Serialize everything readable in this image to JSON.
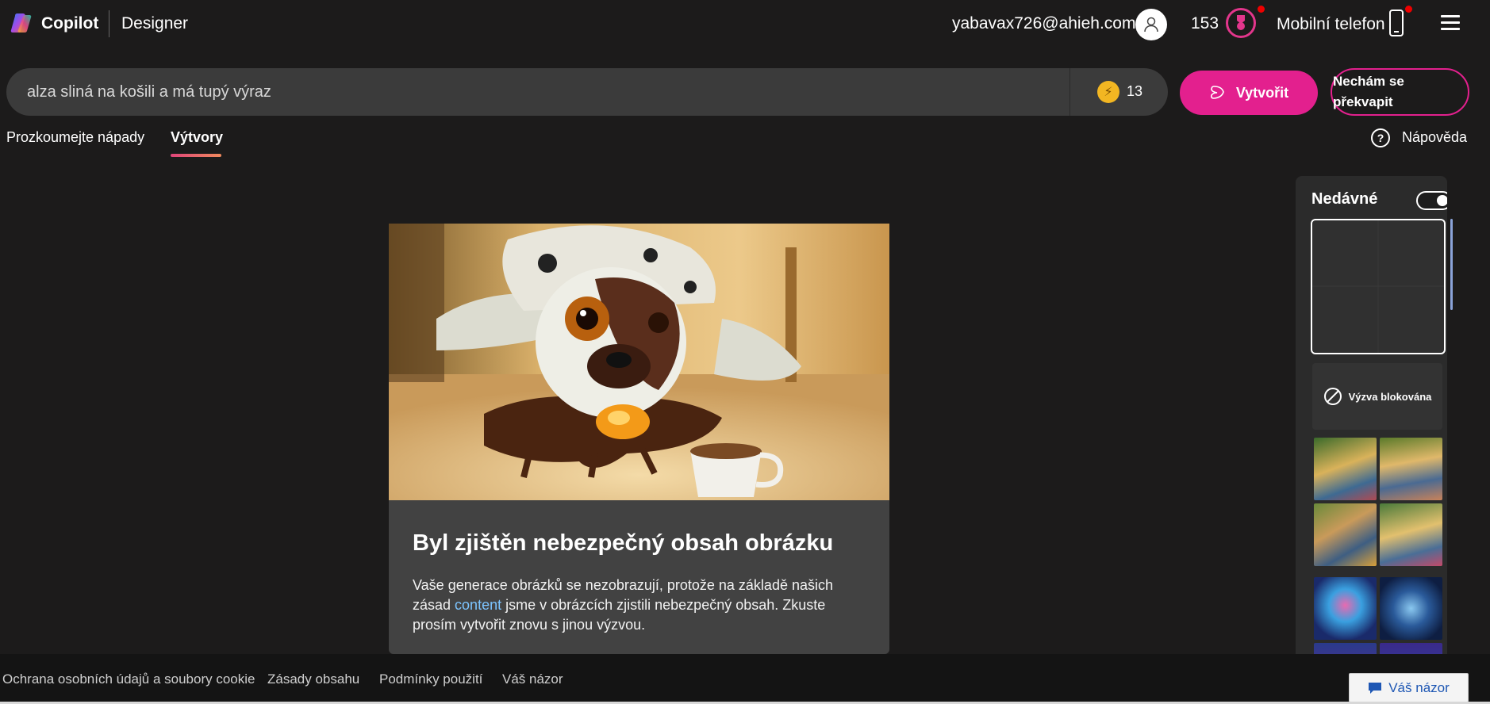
{
  "header": {
    "brand": "Copilot",
    "product": "Designer",
    "email": "yabavax726@ahieh.com",
    "points": "153",
    "mobile_label": "Mobilní telefon"
  },
  "search": {
    "value": "alza sliná na košili a má tupý výraz",
    "boost_count": "13"
  },
  "actions": {
    "create_label": "Vytvořit",
    "surprise_label": "Nechám se překvapit"
  },
  "tabs": [
    {
      "label": "Prozkoumejte nápady",
      "active": false
    },
    {
      "label": "Výtvory",
      "active": true
    }
  ],
  "help_label": "Nápověda",
  "result": {
    "title": "Byl zjištěn nebezpečný obsah obrázku",
    "text_before": "Vaše generace obrázků se nezobrazují, protože na základě našich zásad ",
    "link": "content",
    "text_after": " jsme v obrázcích zjistili nebezpečný obsah. Zkuste prosím vytvořit znovu s jinou výzvou."
  },
  "recent": {
    "title": "Nedávné",
    "toggle_on": true,
    "blocked_label": "Výzva blokována"
  },
  "footer": {
    "links": [
      "Ochrana osobních údajů a soubory cookie",
      "Zásady obsahu",
      "Podmínky použití",
      "Váš názor"
    ],
    "feedback_button": "Váš názor"
  },
  "colors": {
    "accent": "#e3208e",
    "background": "#1c1b1b",
    "link": "#7cc4ff"
  }
}
